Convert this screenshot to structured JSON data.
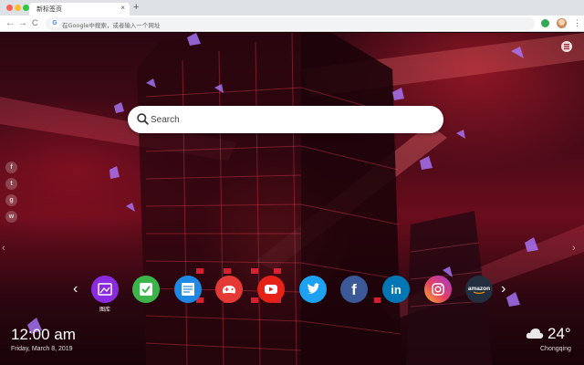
{
  "browser": {
    "tab_title": "新标签页",
    "tab_close": "×",
    "new_tab": "+",
    "address_placeholder": "在Google中搜索，或者输入一个网址",
    "nav": {
      "back": "←",
      "forward": "→",
      "reload": "C"
    }
  },
  "search": {
    "placeholder": "Search"
  },
  "social": [
    {
      "icon": "facebook-icon",
      "glyph": "f"
    },
    {
      "icon": "twitter-icon",
      "glyph": "t"
    },
    {
      "icon": "google-plus-icon",
      "glyph": "g"
    },
    {
      "icon": "wechat-icon",
      "glyph": "w"
    }
  ],
  "dock": {
    "prev": "‹",
    "next": "›",
    "apps": [
      {
        "name": "图库",
        "icon": "gallery-icon",
        "color": "#8a2be2",
        "label": "图库"
      },
      {
        "name": "tasks",
        "icon": "checkmark-icon",
        "color": "#3bb54a"
      },
      {
        "name": "notes",
        "icon": "notes-icon",
        "color": "#1e88e5"
      },
      {
        "name": "games",
        "icon": "gamepad-icon",
        "color": "#e53935"
      },
      {
        "name": "youtube",
        "icon": "youtube-icon",
        "color": "#e62117"
      },
      {
        "name": "twitter",
        "icon": "twitter-icon",
        "color": "#1da1f2"
      },
      {
        "name": "facebook",
        "icon": "facebook-icon",
        "color": "#3b5998"
      },
      {
        "name": "linkedin",
        "icon": "linkedin-icon",
        "color": "#0077b5"
      },
      {
        "name": "instagram",
        "icon": "instagram-icon",
        "color": "#d6249f"
      },
      {
        "name": "amazon",
        "icon": "amazon-icon",
        "color": "#232f3e",
        "text": "amazon"
      }
    ]
  },
  "clock": {
    "time": "12:00 am",
    "date": "Friday, March 8, 2019"
  },
  "weather": {
    "temp": "24°",
    "city": "Chongqing",
    "icon": "cloud-icon"
  },
  "colors": {
    "accent": "#d2102c",
    "search_bg": "#ffffff"
  }
}
